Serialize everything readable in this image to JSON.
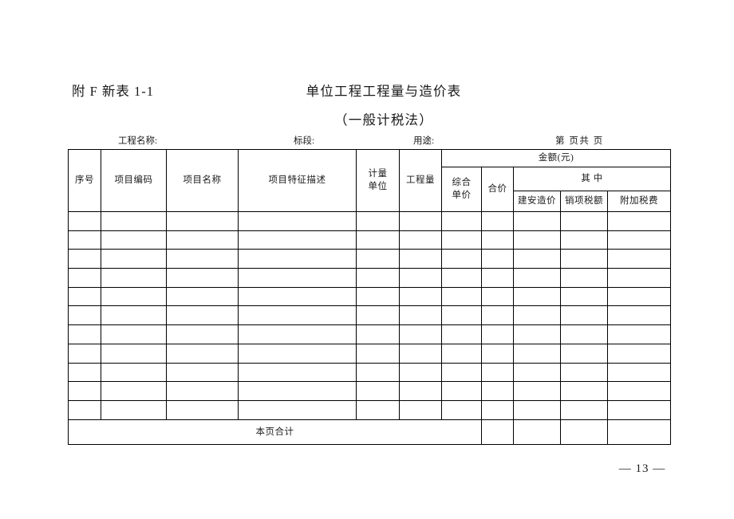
{
  "document": {
    "form_code": "附 F 新表 1-1",
    "title": "单位工程工程量与造价表",
    "subtitle": "（一般计税法）",
    "page_footer": "— 13 —"
  },
  "info": {
    "project_name_label": "工程名称:",
    "section_label": "标段:",
    "usage_label": "用途:",
    "page_label": "第 页共 页"
  },
  "table": {
    "headers": {
      "seq": "序号",
      "item_code": "项目编码",
      "item_name": "项目名称",
      "item_feature": "项目特征描述",
      "unit_line1": "计量",
      "unit_line2": "单位",
      "quantity": "工程量",
      "amount_group": "金额(元)",
      "unit_price_line1": "综合",
      "unit_price_line2": "单价",
      "total_price": "合价",
      "among_which": "其  中",
      "construction_cost": "建安造价",
      "output_tax": "销项税额",
      "surcharge": "附加税费"
    },
    "row_count": 11,
    "total_row_label": "本页合计",
    "cells": {
      "empty": ""
    }
  }
}
